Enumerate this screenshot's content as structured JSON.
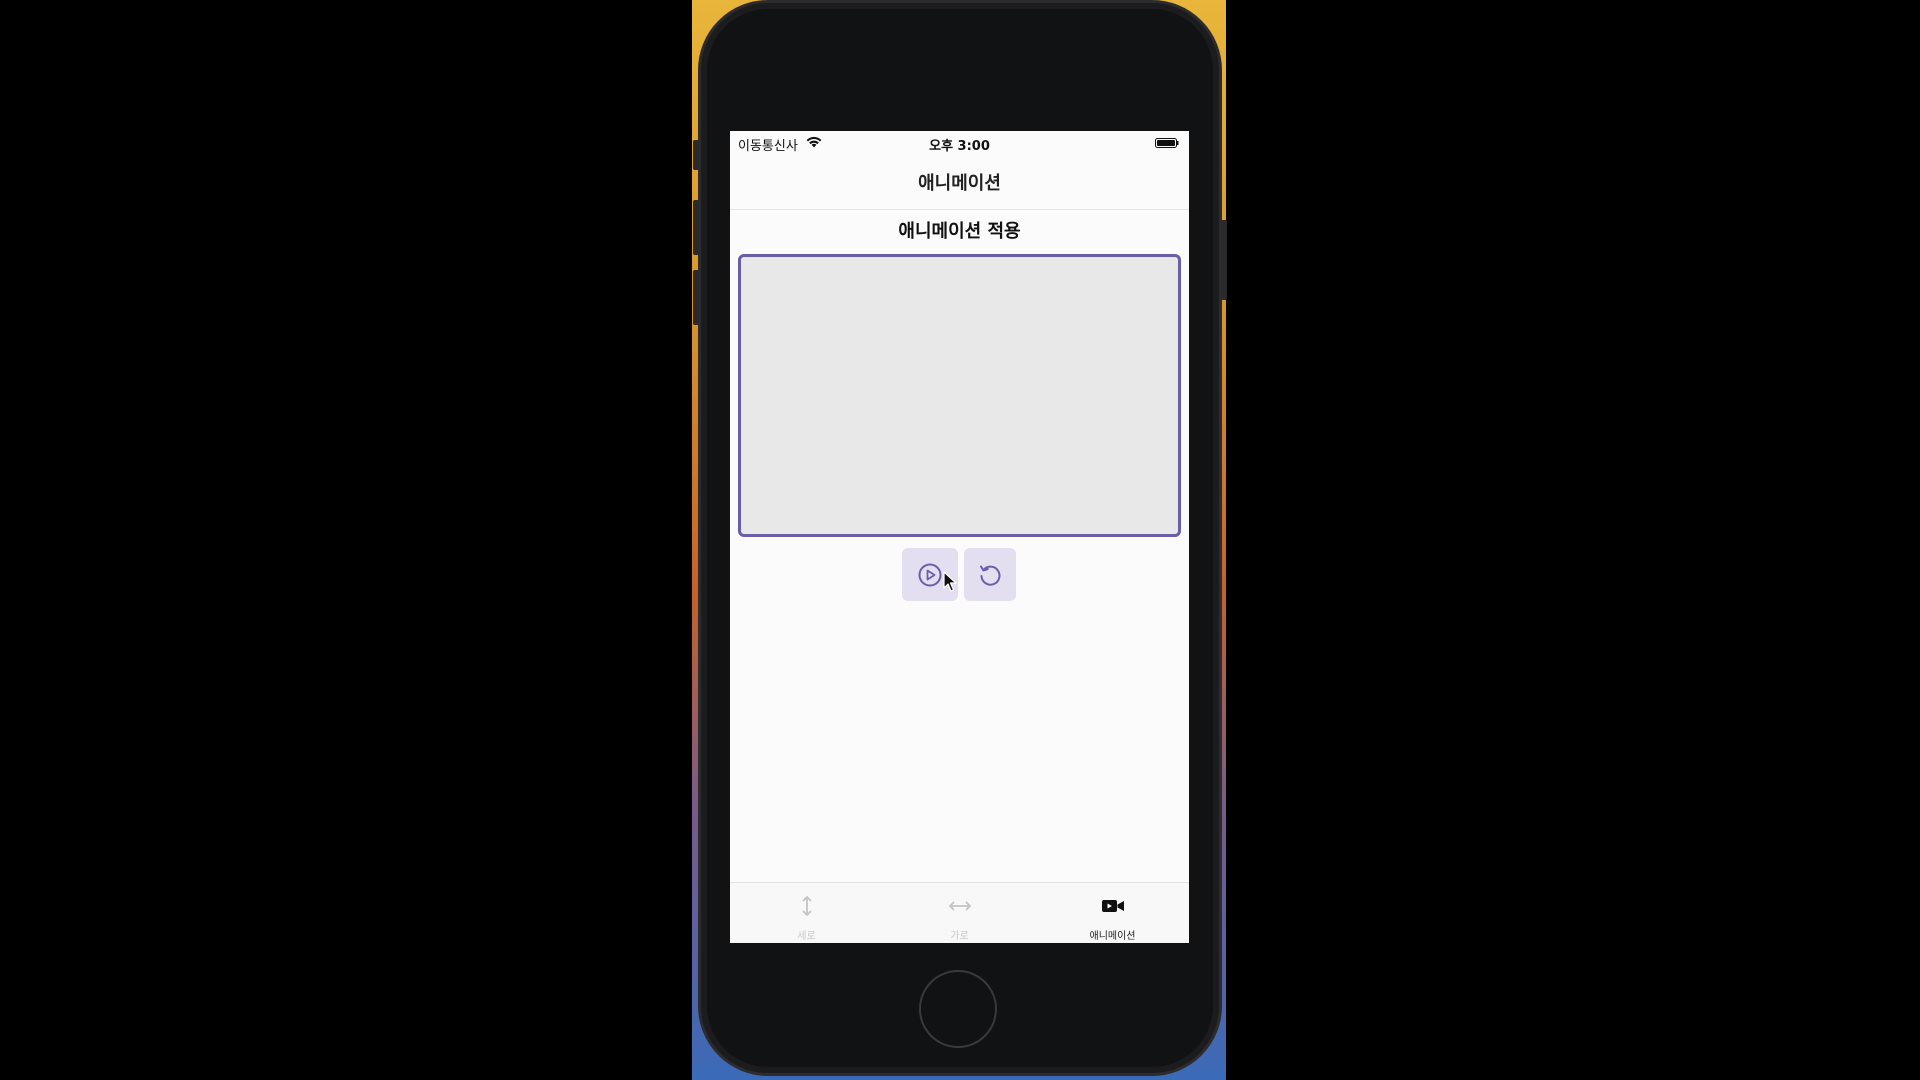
{
  "status_bar": {
    "carrier": "이동통신사",
    "time": "오후 3:00"
  },
  "nav": {
    "title": "애니메이션"
  },
  "main": {
    "section_title": "애니메이션 적용",
    "controls": [
      {
        "name": "play",
        "icon": "play-circle-icon"
      },
      {
        "name": "reset",
        "icon": "rotate-ccw-icon"
      }
    ]
  },
  "tab_bar": {
    "tabs": [
      {
        "label": "세로",
        "icon": "vertical-arrows-icon",
        "active": false
      },
      {
        "label": "가로",
        "icon": "horizontal-arrows-icon",
        "active": false
      },
      {
        "label": "애니메이션",
        "icon": "video-camera-icon",
        "active": true
      }
    ]
  },
  "colors": {
    "accent": "#6b5ea8",
    "button_bg": "#e4dff0",
    "box_bg": "#e8e8e8"
  }
}
